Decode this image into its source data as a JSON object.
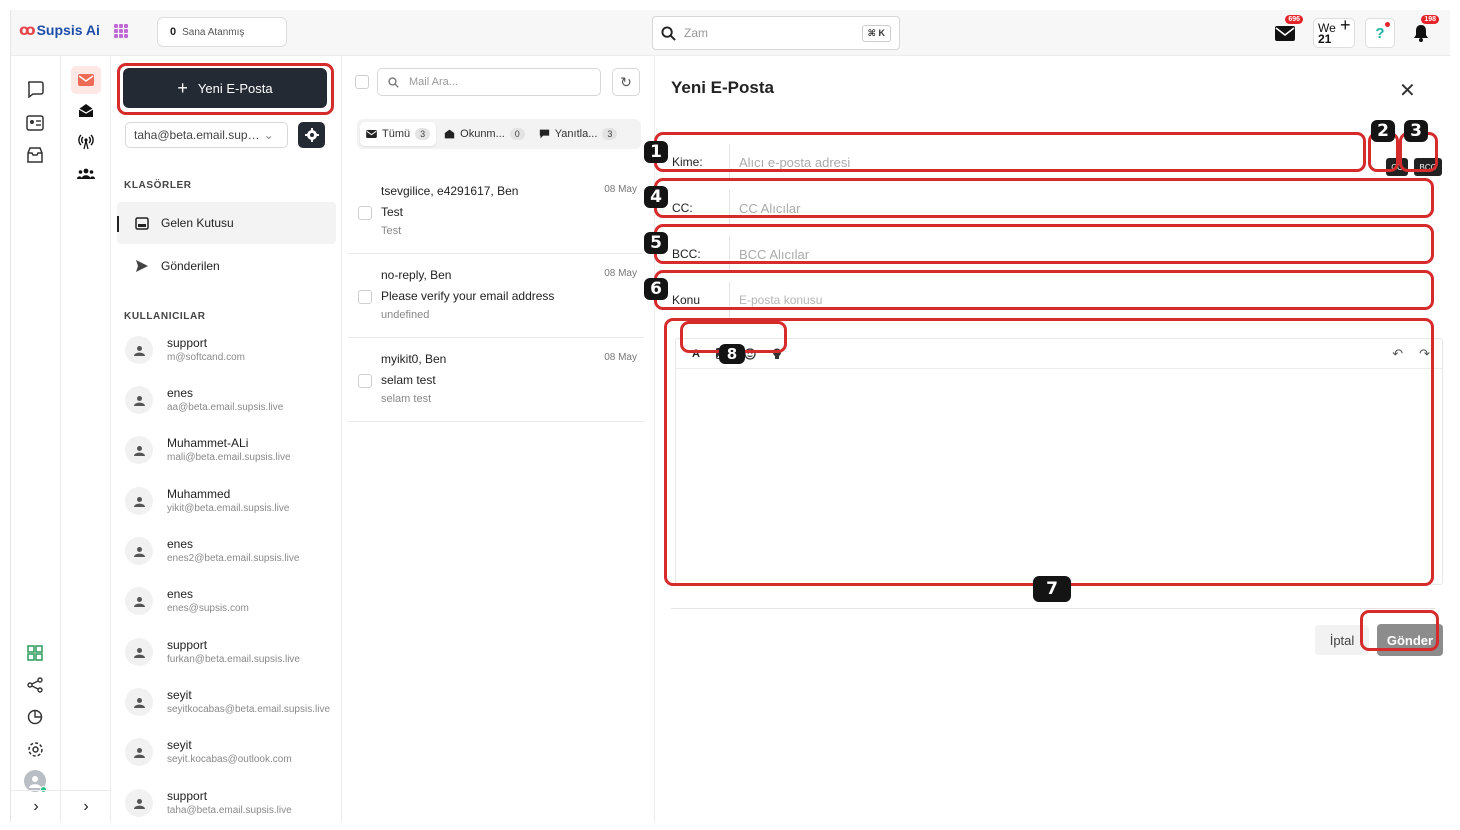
{
  "topbar": {
    "logo_mark": "ꝏ",
    "logo_text": "Supsis Ai",
    "assigned_count": "0",
    "assigned_label": "Sana Atanmış",
    "search_placeholder": "Zam",
    "search_shortcut": "⌘ K",
    "mail_badge": "696",
    "we_label": "We",
    "we_number": "21",
    "help_label": "?",
    "notif_badge": "198"
  },
  "panel": {
    "new_mail_label": "Yeni E-Posta",
    "account": "taha@beta.email.sup…",
    "folders_title": "KLASÖRLER",
    "folders": [
      {
        "label": "Gelen Kutusu",
        "icon": "inbox-icon",
        "selected": true
      },
      {
        "label": "Gönderilen",
        "icon": "send-icon",
        "selected": false
      }
    ],
    "users_title": "KULLANICILAR",
    "users": [
      {
        "name": "support",
        "email": "m@softcand.com"
      },
      {
        "name": "enes",
        "email": "aa@beta.email.supsis.live"
      },
      {
        "name": "Muhammet-ALi",
        "email": "mali@beta.email.supsis.live"
      },
      {
        "name": "Muhammed",
        "email": "yikit@beta.email.supsis.live"
      },
      {
        "name": "enes",
        "email": "enes2@beta.email.supsis.live"
      },
      {
        "name": "enes",
        "email": "enes@supsis.com"
      },
      {
        "name": "support",
        "email": "furkan@beta.email.supsis.live"
      },
      {
        "name": "seyit",
        "email": "seyitkocabas@beta.email.supsis.live"
      },
      {
        "name": "seyit",
        "email": "seyit.kocabas@outlook.com"
      },
      {
        "name": "support",
        "email": "taha@beta.email.supsis.live"
      }
    ]
  },
  "list": {
    "search_placeholder": "Mail Ara...",
    "tabs": [
      {
        "label": "Tümü",
        "count": "3"
      },
      {
        "label": "Okunm...",
        "count": "0"
      },
      {
        "label": "Yanıtla...",
        "count": "3"
      }
    ],
    "mails": [
      {
        "from": "tsevgilice, e4291617, Ben",
        "date": "08 May",
        "subject": "Test",
        "preview": "Test"
      },
      {
        "from": "no-reply, Ben",
        "date": "08 May",
        "subject": "Please verify your email address",
        "preview": "undefined"
      },
      {
        "from": "myikit0, Ben",
        "date": "08 May",
        "subject": "selam test",
        "preview": "selam test"
      }
    ]
  },
  "compose": {
    "title": "Yeni E-Posta",
    "to_label": "Kime:",
    "to_placeholder": "Alıcı e-posta adresi",
    "cc_toggle": "CC",
    "bcc_toggle": "BCC",
    "cc_label": "CC:",
    "cc_placeholder": "CC Alıcılar",
    "bcc_label": "BCC:",
    "bcc_placeholder": "BCC Alıcılar",
    "subject_label": "Konu",
    "subject_placeholder": "E-posta konusu",
    "toolbar_text": "A",
    "cancel_label": "İptal",
    "send_label": "Gönder"
  },
  "annotations": {
    "n1": "1",
    "n2": "2",
    "n3": "3",
    "n4": "4",
    "n5": "5",
    "n6": "6",
    "n7": "7",
    "n8": "8"
  },
  "colors": {
    "accent_red": "#d52b2b",
    "dark_button": "#232a33",
    "brand_blue": "#1d4ea8",
    "send_disabled": "#8c8c8c"
  }
}
